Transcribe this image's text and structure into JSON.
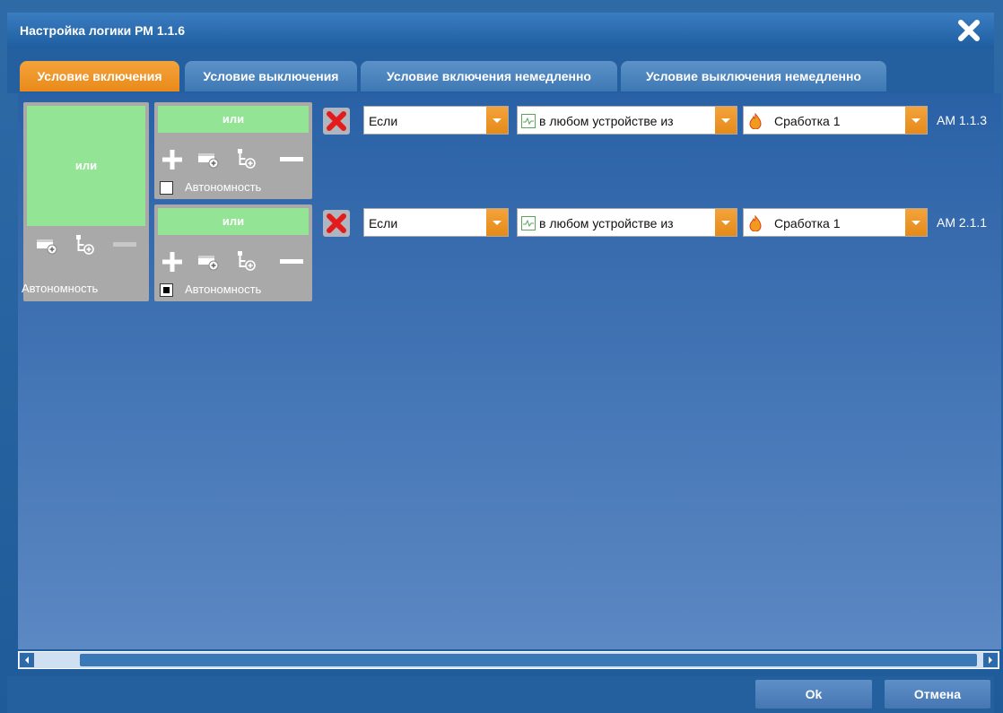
{
  "window": {
    "title": "Настройка логики РМ 1.1.6",
    "close_icon": "close-x-icon"
  },
  "tabs": [
    {
      "label": "Условие включения",
      "active": true
    },
    {
      "label": "Условие выключения",
      "active": false
    },
    {
      "label": "Условие включения немедленно",
      "active": false
    },
    {
      "label": "Условие выключения немедленно",
      "active": false
    }
  ],
  "outer_group": {
    "operator": "или",
    "autonomy_label": "Автономность"
  },
  "inner_groups": [
    {
      "operator": "или",
      "autonomy_label": "Автономность",
      "autonomy_checked": false
    },
    {
      "operator": "или",
      "autonomy_label": "Автономность",
      "autonomy_checked": true
    }
  ],
  "conditions": [
    {
      "condition": "Если",
      "scope": "в любом устройстве из",
      "event": "Сработка 1",
      "address": "АМ 1.1.3"
    },
    {
      "condition": "Если",
      "scope": "в любом устройстве из",
      "event": "Сработка 1",
      "address": "АМ 2.1.1"
    }
  ],
  "buttons": {
    "ok": "Ok",
    "cancel": "Отмена"
  },
  "colors": {
    "accent": "#e98a1a",
    "or_green": "#93e495",
    "panel_blue": "#2a61a6",
    "delete_red": "#e31b1b"
  }
}
